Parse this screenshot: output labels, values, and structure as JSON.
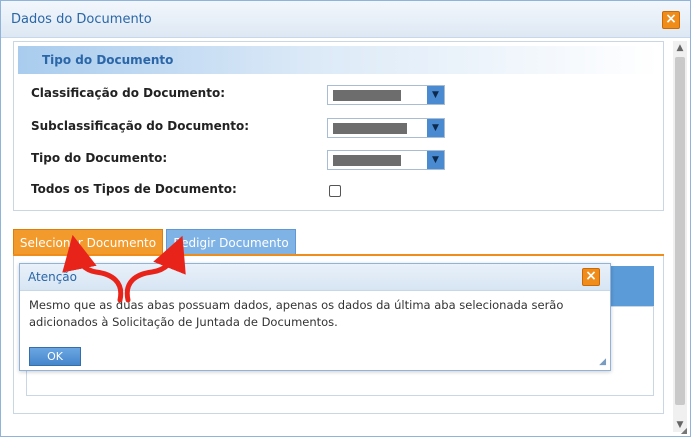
{
  "dialog": {
    "title": "Dados do Documento",
    "close_glyph": "×"
  },
  "section": {
    "title": "Tipo do Documento"
  },
  "form": {
    "classificacao_label": "Classificação do Documento:",
    "subclassificacao_label": "Subclassificação do Documento:",
    "tipo_label": "Tipo do Documento:",
    "todos_tipos_label": "Todos os Tipos de Documento:"
  },
  "tabs": [
    {
      "label": "Selecionar Documento",
      "active": true
    },
    {
      "label": "Redigir Documento",
      "active": false
    }
  ],
  "alert": {
    "title": "Atenção",
    "message": "Mesmo que as duas abas possuam dados, apenas os dados da última aba selecionada serão adicionados à Solicitação de Juntada de Documentos.",
    "ok_label": "OK",
    "close_glyph": "×"
  },
  "scrollbar": {
    "up_glyph": "▲",
    "down_glyph": "▼"
  },
  "icons": {
    "dropdown_arrow": "▼",
    "resize_grip": "◢"
  },
  "colors": {
    "accent_orange": "#f08c1a",
    "accent_blue": "#4a8ad0",
    "title_blue": "#2a66a8",
    "callout_red": "#e8231a"
  }
}
